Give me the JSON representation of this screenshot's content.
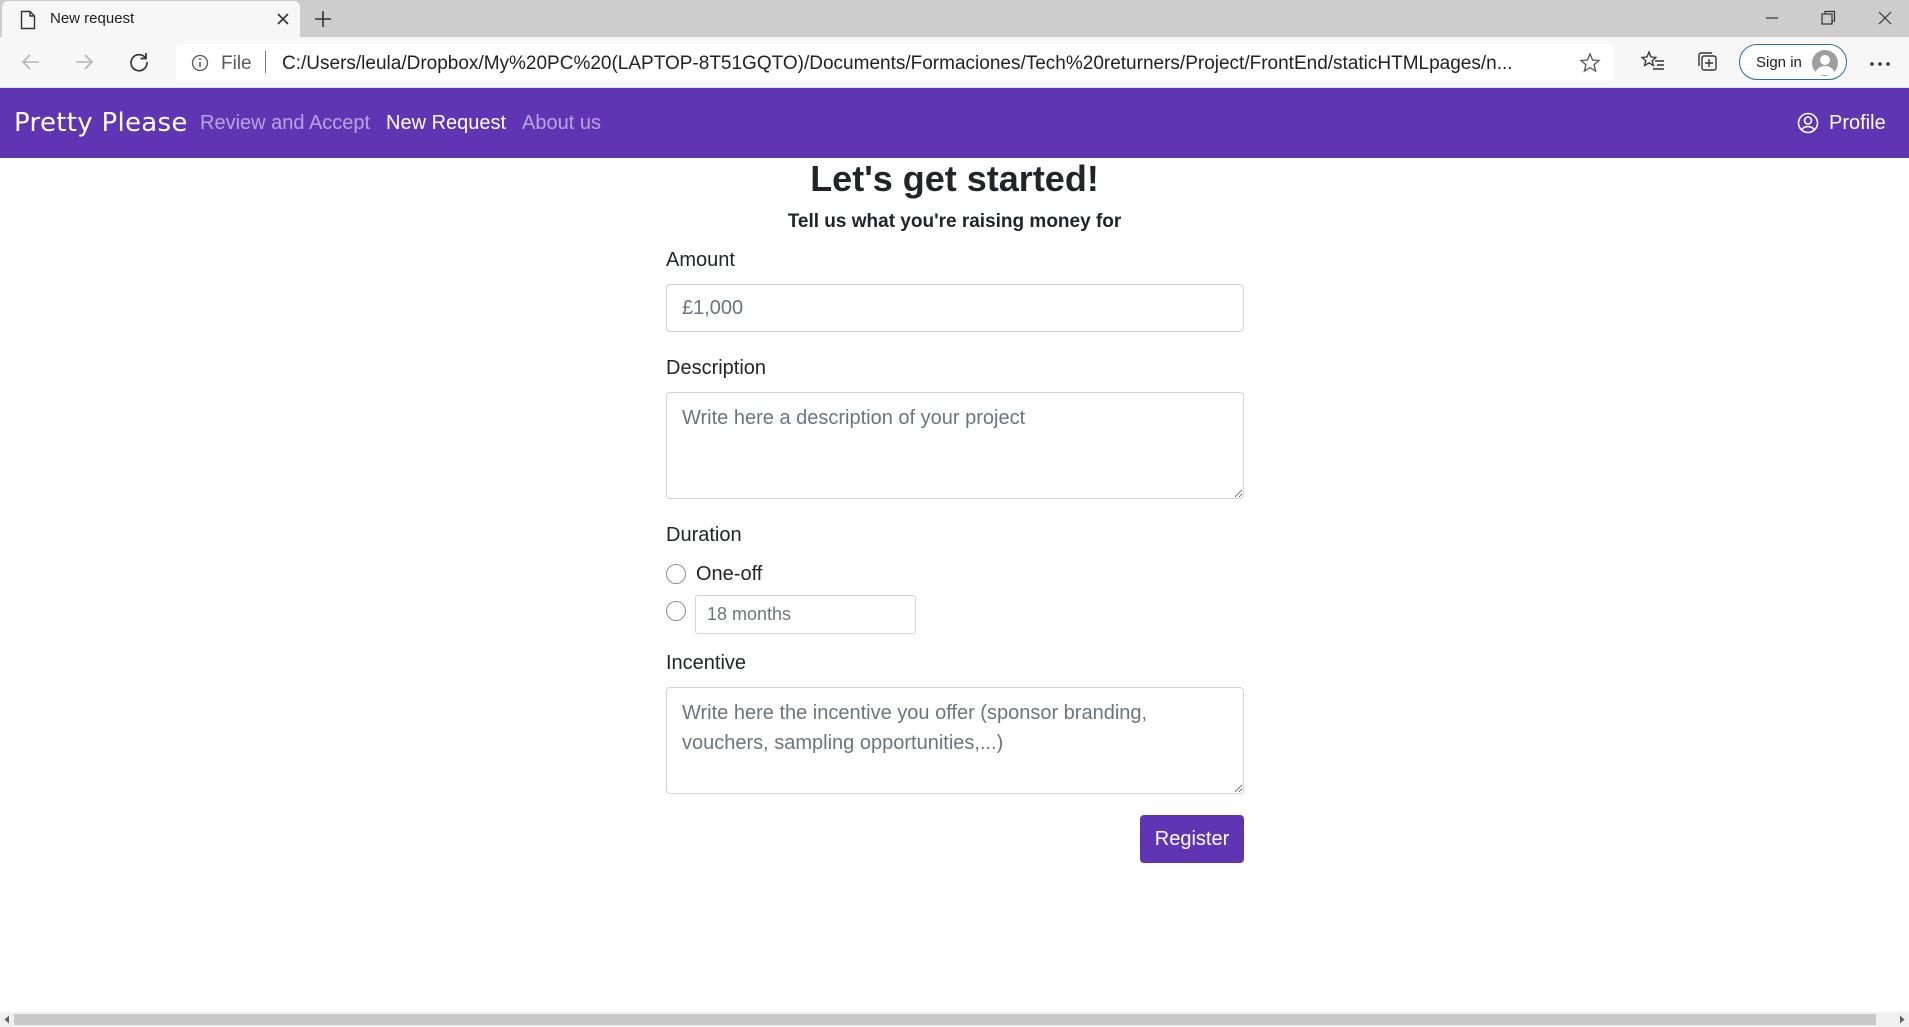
{
  "browser": {
    "tab_title": "New request",
    "file_label": "File",
    "url": "C:/Users/leula/Dropbox/My%20PC%20(LAPTOP-8T51GQTO)/Documents/Formaciones/Tech%20returners/Project/FrontEnd/staticHTMLpages/n...",
    "signin_label": "Sign in"
  },
  "navbar": {
    "brand": "Pretty Please",
    "links": [
      {
        "label": "Review and Accept",
        "active": false
      },
      {
        "label": "New Request",
        "active": true
      },
      {
        "label": "About us",
        "active": false
      }
    ],
    "profile_label": "Profile"
  },
  "form": {
    "heading": "Let's get started!",
    "subheading": "Tell us what you're raising money for",
    "amount_label": "Amount",
    "amount_placeholder": "£1,000",
    "description_label": "Description",
    "description_placeholder": "Write here a description of your project",
    "duration_label": "Duration",
    "duration_option_oneoff": "One-off",
    "duration_months_placeholder": "18 months",
    "incentive_label": "Incentive",
    "incentive_placeholder": "Write here the incentive you offer (sponsor branding, vouchers, sampling opportunities,...)",
    "register_label": "Register"
  },
  "colors": {
    "primary": "#6035b3"
  }
}
